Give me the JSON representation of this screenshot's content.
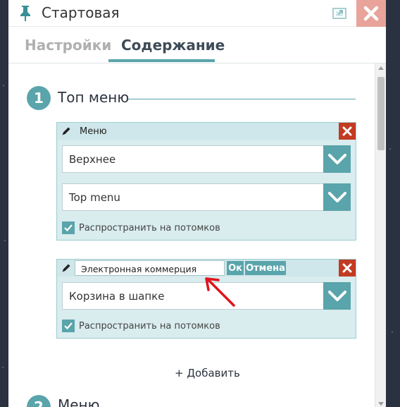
{
  "window": {
    "title": "Стартовая"
  },
  "tabs": [
    {
      "label": "Настройки",
      "active": false
    },
    {
      "label": "Содержание",
      "active": true
    }
  ],
  "sections": [
    {
      "number": "1",
      "title": "Топ меню"
    },
    {
      "number": "2",
      "title": "Меню"
    }
  ],
  "menu_blocks": [
    {
      "name": "Меню",
      "selects": [
        {
          "value": "Верхнее"
        },
        {
          "value": "Top menu"
        }
      ],
      "propagate_label": "Распространить на потомков",
      "propagate_checked": true
    },
    {
      "name_input_value": "Электронная коммерция",
      "ok_label": "Ок",
      "cancel_label": "Отмена",
      "selects": [
        {
          "value": "Корзина в шапке"
        }
      ],
      "propagate_label": "Распространить на потомков",
      "propagate_checked": true
    }
  ],
  "add_label": "+ Добавить",
  "colors": {
    "accent": "#5aa4ab",
    "close_button": "#e8a49a",
    "remove_button": "#c23b22",
    "annotation_arrow": "#e0141e"
  }
}
